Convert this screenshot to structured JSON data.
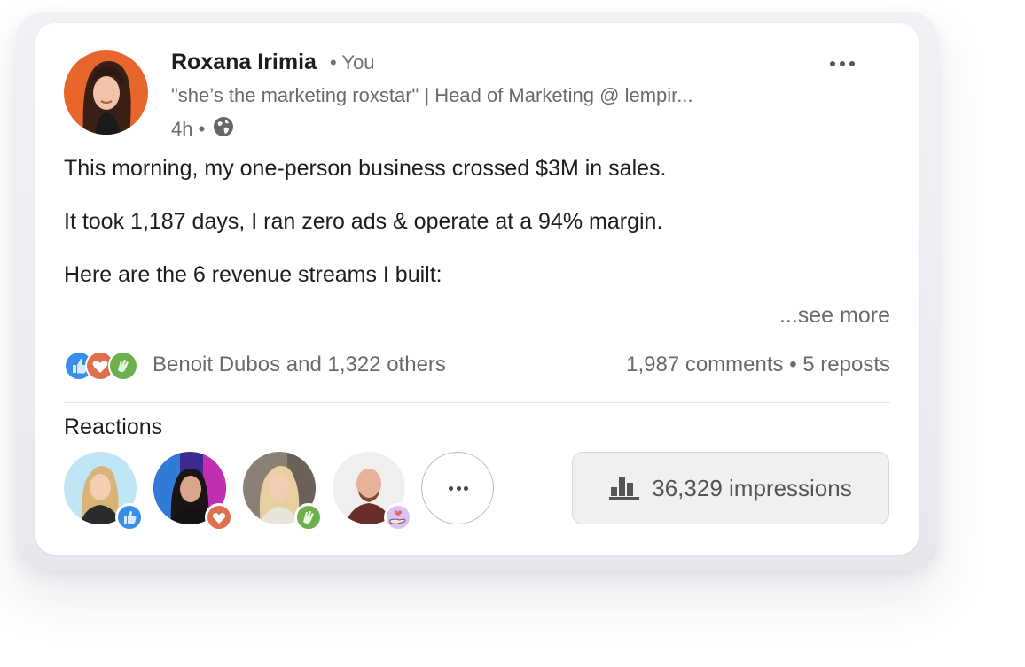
{
  "post": {
    "author": "Roxana Irimia",
    "you_tag": "• You",
    "headline": "\"she’s the marketing roxstar\" | Head of Marketing @ lempir...",
    "time": "4h •",
    "lines": [
      "This morning, my one-person business crossed $3M in sales.",
      "It took 1,187 days, I ran zero ads & operate at a 94% margin.",
      "Here are the 6 revenue streams I built:"
    ],
    "see_more": "...see more"
  },
  "social": {
    "reactor_name": "Benoit Dubos",
    "others": "and 1,322 others",
    "comments": "1,987 comments",
    "separator": "•",
    "reposts": "5 reposts"
  },
  "reactions_section": {
    "title": "Reactions",
    "impressions": "36,329 impressions"
  },
  "icons": {
    "more": "more-horizontal-icon",
    "visibility": "globe-icon",
    "like": "like-icon",
    "love": "love-icon",
    "celebrate": "celebrate-icon",
    "support": "support-icon",
    "analytics": "bar-chart-icon"
  },
  "colors": {
    "like": "#378fe9",
    "love": "#df704d",
    "celebrate": "#44712e",
    "support": "#d7c4f0",
    "avatar_bg": "#e8652b"
  }
}
